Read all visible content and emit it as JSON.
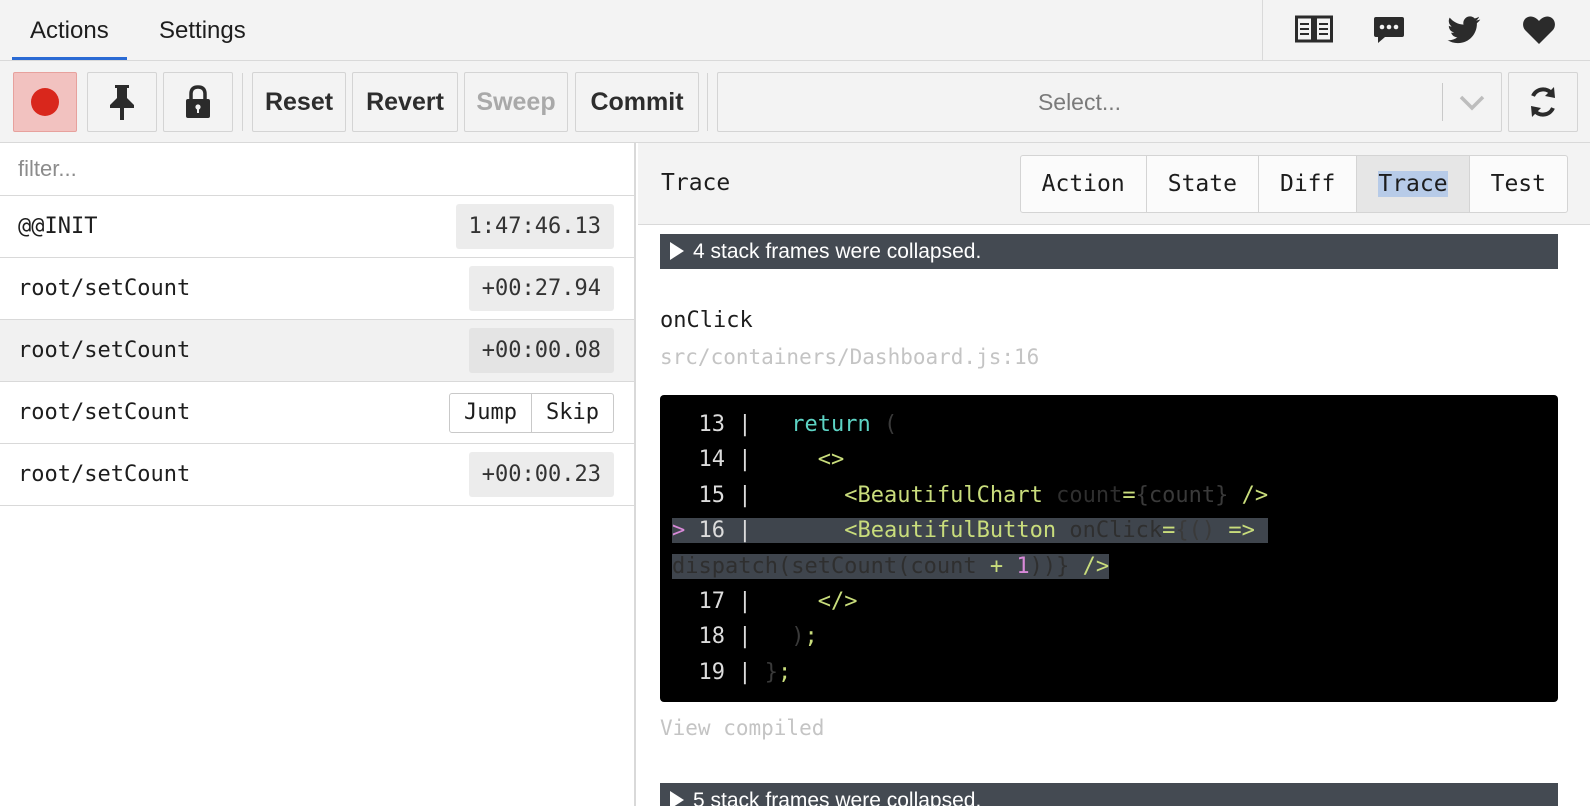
{
  "tabs": {
    "actions": "Actions",
    "settings": "Settings"
  },
  "top_icons": [
    "book-icon",
    "chat-icon",
    "twitter-icon",
    "heart-icon"
  ],
  "toolbar": {
    "reset": "Reset",
    "revert": "Revert",
    "sweep": "Sweep",
    "commit": "Commit",
    "select_placeholder": "Select..."
  },
  "left": {
    "filter_placeholder": "filter...",
    "actions": [
      {
        "name": "@@INIT",
        "time": "1:47:46.13"
      },
      {
        "name": "root/setCount",
        "time": "+00:27.94"
      },
      {
        "name": "root/setCount",
        "time": "+00:00.08"
      },
      {
        "name": "root/setCount",
        "jump": "Jump",
        "skip": "Skip"
      },
      {
        "name": "root/setCount",
        "time": "+00:00.23"
      }
    ]
  },
  "right": {
    "title": "Trace",
    "view_tabs": [
      "Action",
      "State",
      "Diff",
      "Trace",
      "Test"
    ],
    "collapsed_top": "4 stack frames were collapsed.",
    "frame_function": "onClick",
    "frame_file": "src/containers/Dashboard.js:16",
    "code": {
      "l13_num": "13",
      "l13_kw": "return",
      "l13_paren": "(",
      "l14_num": "14",
      "l14_tag": "<>",
      "l15_num": "15",
      "l15_tag": "<BeautifulChart",
      "l15_attr": "count",
      "l15_eq": "=",
      "l15_expr": "{count}",
      "l15_close": "/>",
      "l16_marker": ">",
      "l16_num": "16",
      "l16_tag": "<BeautifulButton",
      "l16_attr": "onClick",
      "l16_eq": "=",
      "l16_expr_a": "{()",
      "l16_arrow": "=>",
      "l16_cont_a": "dispatch(setCount(count",
      "l16_plus": "+",
      "l16_one": "1",
      "l16_cont_b": "))}",
      "l16_close": "/>",
      "l17_num": "17",
      "l17_tag": "</>",
      "l18_num": "18",
      "l18_paren": ")",
      "l18_semi": ";",
      "l19_num": "19",
      "l19_brace": "}",
      "l19_semi": ";"
    },
    "view_compiled": "View compiled",
    "collapsed_bottom": "5 stack frames were collapsed."
  },
  "colors": {
    "tab_accent": "#2a6ad4",
    "record": "#d9271c",
    "code_bg": "#000000",
    "collapsed_bar": "#444a52"
  }
}
